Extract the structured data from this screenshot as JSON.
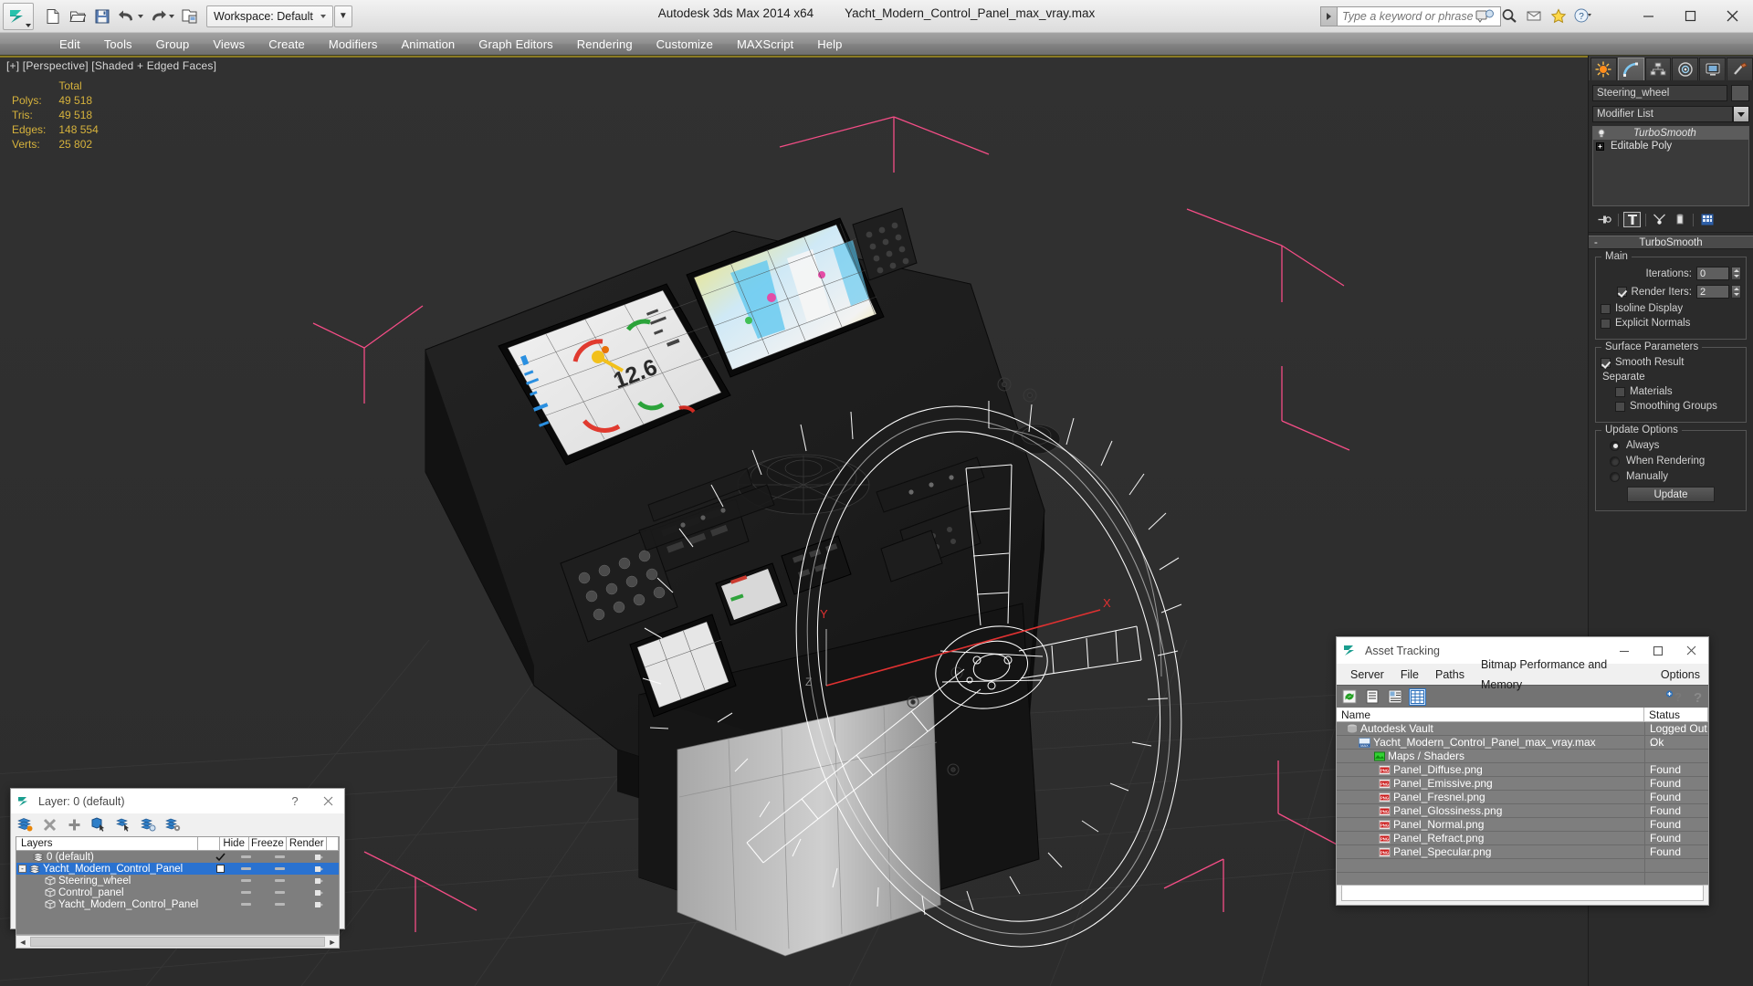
{
  "titlebar": {
    "app_title": "Autodesk 3ds Max  2014 x64",
    "file_title": "Yacht_Modern_Control_Panel_max_vray.max",
    "workspace_label": "Workspace: Default",
    "search_placeholder": "Type a keyword or phrase",
    "quick_access": [
      {
        "name": "new-file-icon",
        "label": "New"
      },
      {
        "name": "open-file-icon",
        "label": "Open"
      },
      {
        "name": "save-file-icon",
        "label": "Save"
      },
      {
        "name": "undo-icon",
        "label": "Undo"
      },
      {
        "name": "redo-icon",
        "label": "Redo"
      },
      {
        "name": "project-folder-icon",
        "label": "Set Project Folder"
      }
    ],
    "window_controls": {
      "minimize": "─",
      "maximize": "☐",
      "close": "✕"
    }
  },
  "menubar": {
    "items": [
      "Edit",
      "Tools",
      "Group",
      "Views",
      "Create",
      "Modifiers",
      "Animation",
      "Graph Editors",
      "Rendering",
      "Customize",
      "MAXScript",
      "Help"
    ]
  },
  "viewport": {
    "label": "[+] [Perspective] [Shaded + Edged Faces]",
    "stats": {
      "header": "Total",
      "rows": [
        {
          "label": "Polys:",
          "value": "49 518"
        },
        {
          "label": "Tris:",
          "value": "49 518"
        },
        {
          "label": "Edges:",
          "value": "148 554"
        },
        {
          "label": "Verts:",
          "value": "25 802"
        }
      ]
    },
    "gizmo_axes": [
      "X",
      "Y",
      "Z"
    ],
    "background_color": "#2f2f2f",
    "selection_color": "#ffffff",
    "bbox_color": "#ff4f8b"
  },
  "command_panel": {
    "tabs": [
      {
        "name": "create-tab",
        "label": "Create"
      },
      {
        "name": "modify-tab",
        "label": "Modify"
      },
      {
        "name": "hierarchy-tab",
        "label": "Hierarchy"
      },
      {
        "name": "motion-tab",
        "label": "Motion"
      },
      {
        "name": "display-tab",
        "label": "Display"
      },
      {
        "name": "utilities-tab",
        "label": "Utilities"
      }
    ],
    "active_tab": "modify-tab",
    "object_name": "Steering_wheel",
    "modifier_list_label": "Modifier List",
    "modifier_stack": [
      {
        "label": "TurboSmooth",
        "selected": true
      },
      {
        "label": "Editable Poly",
        "selected": false
      }
    ],
    "stack_buttons": [
      {
        "name": "pin-stack-icon"
      },
      {
        "name": "show-end-result-icon"
      },
      {
        "name": "make-unique-icon"
      },
      {
        "name": "remove-modifier-icon"
      },
      {
        "name": "configure-modifier-sets-icon"
      }
    ],
    "rollout": {
      "title": "TurboSmooth",
      "main_group": "Main",
      "iterations_label": "Iterations:",
      "iterations_value": "0",
      "render_iters_label": "Render Iters:",
      "render_iters_value": "2",
      "render_iters_checked": true,
      "isoline_display_label": "Isoline Display",
      "isoline_display_checked": false,
      "explicit_normals_label": "Explicit Normals",
      "explicit_normals_checked": false,
      "surface_group": "Surface Parameters",
      "smooth_result_label": "Smooth Result",
      "smooth_result_checked": true,
      "separate_label": "Separate",
      "materials_label": "Materials",
      "materials_checked": false,
      "smoothing_groups_label": "Smoothing Groups",
      "smoothing_groups_checked": false,
      "update_group": "Update Options",
      "update_always_label": "Always",
      "update_when_rendering_label": "When Rendering",
      "update_manually_label": "Manually",
      "update_selected": "Always",
      "update_button_label": "Update"
    }
  },
  "asset_tracking": {
    "title": "Asset Tracking",
    "menu": [
      "Server",
      "File",
      "Paths",
      "Bitmap Performance and Memory",
      "Options"
    ],
    "toolbar": [
      {
        "name": "refresh-icon"
      },
      {
        "name": "list-view-icon"
      },
      {
        "name": "detail-view-icon"
      },
      {
        "name": "grid-view-icon",
        "selected": true
      }
    ],
    "toolbar_right": [
      {
        "name": "help-add-icon"
      },
      {
        "name": "help-icon"
      }
    ],
    "columns": [
      "Name",
      "Status"
    ],
    "rows": [
      {
        "name": "Autodesk Vault",
        "status": "Logged Out ..",
        "indent": 0,
        "icon": "vault-icon"
      },
      {
        "name": "Yacht_Modern_Control_Panel_max_vray.max",
        "status": "Ok",
        "indent": 1,
        "icon": "max-file-icon"
      },
      {
        "name": "Maps / Shaders",
        "status": "",
        "indent": 2,
        "icon": "maps-shaders-icon"
      },
      {
        "name": "Panel_Diffuse.png",
        "status": "Found",
        "indent": 3,
        "icon": "png-icon"
      },
      {
        "name": "Panel_Emissive.png",
        "status": "Found",
        "indent": 3,
        "icon": "png-icon"
      },
      {
        "name": "Panel_Fresnel.png",
        "status": "Found",
        "indent": 3,
        "icon": "png-icon"
      },
      {
        "name": "Panel_Glossiness.png",
        "status": "Found",
        "indent": 3,
        "icon": "png-icon"
      },
      {
        "name": "Panel_Normal.png",
        "status": "Found",
        "indent": 3,
        "icon": "png-icon"
      },
      {
        "name": "Panel_Refract.png",
        "status": "Found",
        "indent": 3,
        "icon": "png-icon"
      },
      {
        "name": "Panel_Specular.png",
        "status": "Found",
        "indent": 3,
        "icon": "png-icon"
      }
    ],
    "window_controls": {
      "minimize": "─",
      "maximize": "☐",
      "close": "✕"
    }
  },
  "layer_dialog": {
    "title": "Layer: 0 (default)",
    "help_label": "?",
    "close_label": "✕",
    "toolbar": [
      {
        "name": "create-new-layer-icon"
      },
      {
        "name": "delete-layer-icon"
      },
      {
        "name": "add-selection-to-layer-icon"
      },
      {
        "name": "select-objects-in-layer-icon"
      },
      {
        "name": "highlight-selected-objects-icon"
      },
      {
        "name": "hide-unhide-layer-icon"
      },
      {
        "name": "layer-properties-icon"
      }
    ],
    "columns": [
      "Layers",
      "",
      "Hide",
      "Freeze",
      "Render"
    ],
    "rows": [
      {
        "name": "0 (default)",
        "indent": 0,
        "selected": false,
        "current": true,
        "expander": "",
        "icon": "layer-icon"
      },
      {
        "name": "Yacht_Modern_Control_Panel",
        "indent": 0,
        "selected": true,
        "current": false,
        "expander": "-",
        "icon": "layer-icon"
      },
      {
        "name": "Steering_wheel",
        "indent": 1,
        "selected": false,
        "current": false,
        "expander": "",
        "icon": "object-icon"
      },
      {
        "name": "Control_panel",
        "indent": 1,
        "selected": false,
        "current": false,
        "expander": "",
        "icon": "object-icon"
      },
      {
        "name": "Yacht_Modern_Control_Panel",
        "indent": 1,
        "selected": false,
        "current": false,
        "expander": "",
        "icon": "object-icon"
      }
    ]
  }
}
